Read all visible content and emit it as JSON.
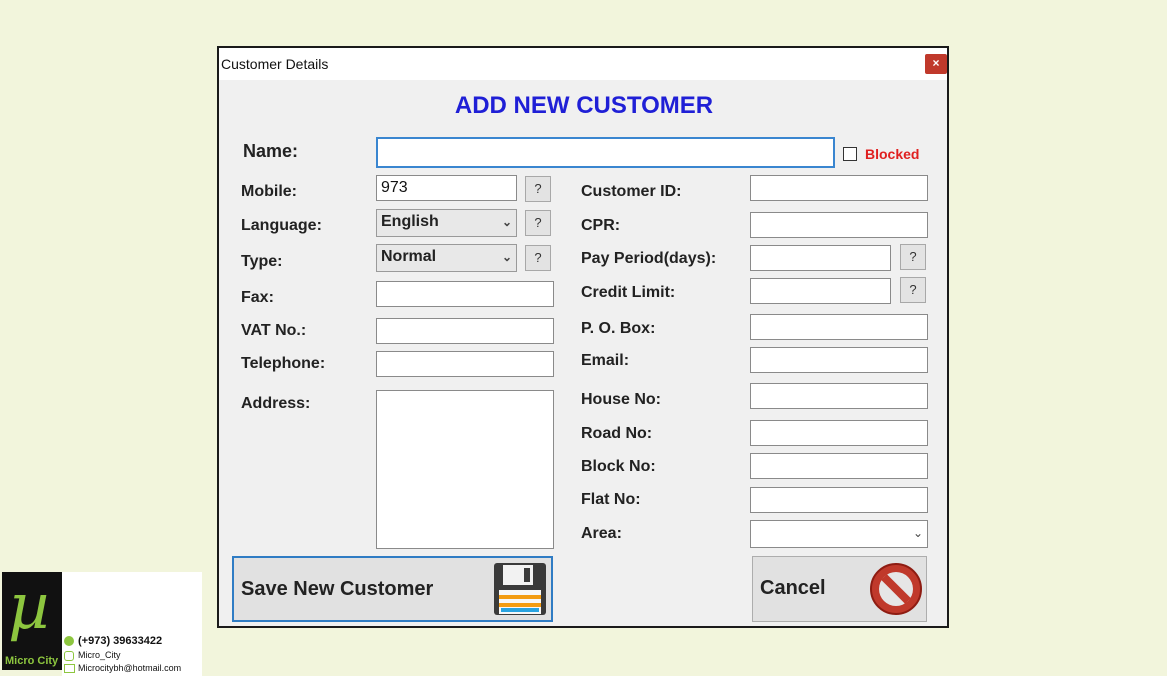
{
  "window": {
    "title": "Customer Details",
    "close_label": "×"
  },
  "heading": "ADD NEW CUSTOMER",
  "name": {
    "label": "Name:",
    "value": "",
    "blocked_label": "Blocked",
    "blocked_checked": false
  },
  "left": {
    "mobile": {
      "label": "Mobile:",
      "value": "973",
      "help": "?"
    },
    "language": {
      "label": "Language:",
      "value": "English",
      "help": "?"
    },
    "type": {
      "label": "Type:",
      "value": "Normal",
      "help": "?"
    },
    "fax": {
      "label": "Fax:",
      "value": ""
    },
    "vat": {
      "label": "VAT No.:",
      "value": ""
    },
    "telephone": {
      "label": "Telephone:",
      "value": ""
    },
    "address": {
      "label": "Address:",
      "value": ""
    }
  },
  "right": {
    "customer_id": {
      "label": "Customer ID:",
      "value": ""
    },
    "cpr": {
      "label": "CPR:",
      "value": ""
    },
    "pay_period": {
      "label": "Pay Period(days):",
      "value": "",
      "help": "?"
    },
    "credit_limit": {
      "label": "Credit Limit:",
      "value": "",
      "help": "?"
    },
    "po_box": {
      "label": "P. O. Box:",
      "value": ""
    },
    "email": {
      "label": "Email:",
      "value": ""
    },
    "house": {
      "label": "House No:",
      "value": ""
    },
    "road": {
      "label": "Road No:",
      "value": ""
    },
    "block": {
      "label": "Block No:",
      "value": ""
    },
    "flat": {
      "label": "Flat No:",
      "value": ""
    },
    "area": {
      "label": "Area:",
      "value": ""
    }
  },
  "buttons": {
    "save": "Save New Customer",
    "cancel": "Cancel"
  },
  "branding": {
    "logo_mark": "µ",
    "logo_text": "Micro City",
    "phone": "(+973) 39633422",
    "instagram": "Micro_City",
    "email": "Microcitybh@hotmail.com"
  },
  "colors": {
    "heading": "#1f1fd6",
    "blocked": "#e02020",
    "focus": "#3a86d0",
    "close": "#c0392b"
  }
}
